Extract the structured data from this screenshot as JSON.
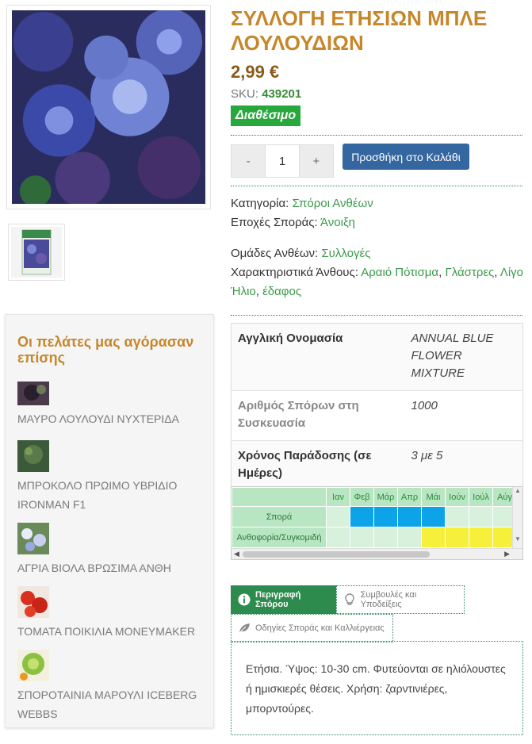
{
  "product": {
    "title": "ΣΥΛΛΟΓΗ ΕΤΗΣΙΩΝ ΜΠΛΕ ΛΟΥΛΟΥΔΙΩΝ",
    "price": "2,99 €",
    "sku_label": "SKU:",
    "sku": "439201",
    "stock": "Διαθέσιμο",
    "qty": "1",
    "minus": "-",
    "plus": "+",
    "add_to_cart": "Προσθήκη στο Καλάθι"
  },
  "meta": {
    "category_label": "Κατηγορία:",
    "category": "Σπόροι Ανθέων",
    "season_label": "Εποχές Σποράς:",
    "season": "Άνοιξη",
    "groups_label": "Ομάδες Ανθέων:",
    "groups": "Συλλογές",
    "traits_label": "Χαρακτηριστικά Άνθους:",
    "traits": [
      "Αραιό Πότισμα",
      "Γλάστρες",
      "Λίγο Ήλιο",
      "έδαφος"
    ]
  },
  "attributes": [
    {
      "key": "Αγγλική Ονομασία",
      "value": "ANNUAL BLUE FLOWER MIXTURE"
    },
    {
      "key": "Αριθμός Σπόρων στη Συσκευασία",
      "value": "1000"
    },
    {
      "key": "Χρόνος Παράδοσης (σε Ημέρες)",
      "value": "3 με 5"
    }
  ],
  "calendar": {
    "months": [
      "Ιαν",
      "Φεβ",
      "Μάρ",
      "Απρ",
      "Μάι",
      "Ιούν",
      "Ιούλ",
      "Αύγ"
    ],
    "rows": [
      {
        "label": "Σπορά",
        "cells": [
          0,
          1,
          1,
          1,
          1,
          0,
          0,
          0
        ]
      },
      {
        "label": "Ανθοφορία/Συγκομιδή",
        "cells": [
          0,
          0,
          0,
          0,
          1,
          1,
          1,
          1
        ]
      }
    ],
    "colors": {
      "sow": "#0ca3e8",
      "flower": "#f6f03a"
    }
  },
  "tabs": [
    {
      "label": "Περιγραφή Σπόρου",
      "icon": "info-icon",
      "active": true
    },
    {
      "label": "Συμβουλές και Υποδείξεις",
      "icon": "lightbulb-icon",
      "active": false
    },
    {
      "label": "Οδηγίες Σποράς και Καλλιέργειας",
      "icon": "leaf-icon",
      "active": false
    }
  ],
  "description": "Ετήσια. Ύψος: 10-30 cm. Φυτεύονται σε ηλιόλουστες ή ημισκιερές θέσεις. Χρήση: ζαρντινιέρες, μπορντούρες.",
  "sidebar": {
    "title": "Οι πελάτες μας αγόρασαν επίσης",
    "items": [
      {
        "name": "ΜΑΥΡΟ ΛΟΥΛΟΥΔΙ ΝΥΧΤΕΡΙΔΑ"
      },
      {
        "name": "ΜΠΡΟΚΟΛΟ ΠΡΩΙΜΟ ΥΒΡΙΔΙΟ IRONMAN F1"
      },
      {
        "name": "ΑΓΡΙΑ ΒΙΟΛΑ ΒΡΩΣΙΜΑ ΑΝΘΗ"
      },
      {
        "name": "ΤΟΜΑΤΑ ΠΟΙΚΙΛΙΑ MONEYMAKER"
      },
      {
        "name": "ΣΠΟΡΟΤΑΙΝΙΑ ΜΑΡΟΥΛΙ ICEBERG WEBBS"
      }
    ]
  }
}
